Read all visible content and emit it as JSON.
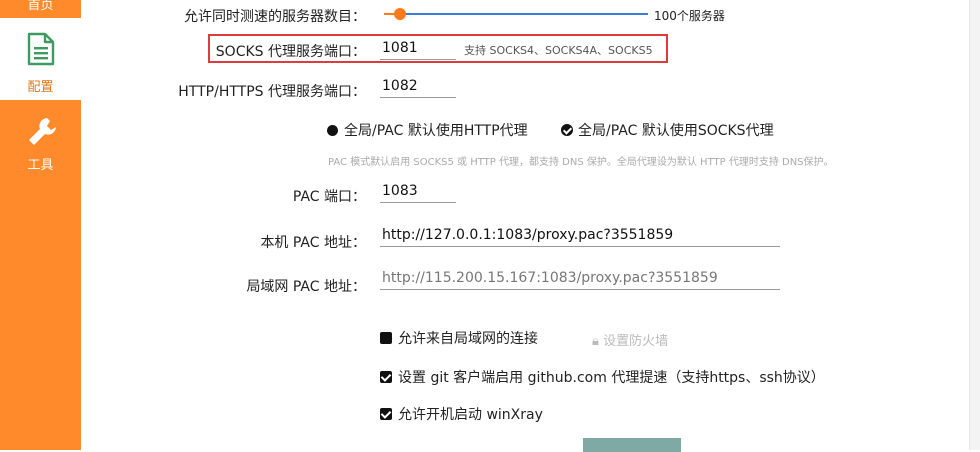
{
  "sidebar": {
    "items": [
      {
        "label": "首页",
        "icon": "home-icon"
      },
      {
        "label": "配置",
        "icon": "document-icon",
        "active": true
      },
      {
        "label": "工具",
        "icon": "wrench-icon"
      }
    ],
    "accent": "#ff8a2b"
  },
  "settings": {
    "max_servers": {
      "label": "允许同时测速的服务器数目：",
      "value_text": "100个服务器",
      "level": 0.06
    },
    "socks_port": {
      "label": "SOCKS 代理服务端口：",
      "value": "1081",
      "hint": "支持 SOCKS4、SOCKS4A、SOCKS5"
    },
    "http_port": {
      "label": "HTTP/HTTPS 代理服务端口：",
      "value": "1082"
    },
    "global_mode": {
      "options": [
        {
          "label": "全局/PAC 默认使用HTTP代理",
          "selected": true
        },
        {
          "label": "全局/PAC 默认使用SOCKS代理",
          "selected": false
        }
      ],
      "note": "PAC 模式默认启用 SOCKS5 或 HTTP 代理，都支持 DNS 保护。全局代理设为默认 HTTP 代理时支持 DNS保护。"
    },
    "pac_port": {
      "label": "PAC 端口：",
      "value": "1083"
    },
    "local_pac": {
      "label": "本机 PAC 地址：",
      "value": "http://127.0.0.1:1083/proxy.pac?3551859"
    },
    "lan_pac": {
      "label": "局域网 PAC 地址：",
      "value": "http://115.200.15.167:1083/proxy.pac?3551859"
    },
    "checks": [
      {
        "label": "允许来自局域网的连接",
        "checked": false
      },
      {
        "label": "设置 git 客户端启用 github.com 代理提速（支持https、ssh协议）",
        "checked": true
      },
      {
        "label": "允许开机启动 winXray",
        "checked": true
      }
    ],
    "firewall_label": "设置防火墙"
  }
}
